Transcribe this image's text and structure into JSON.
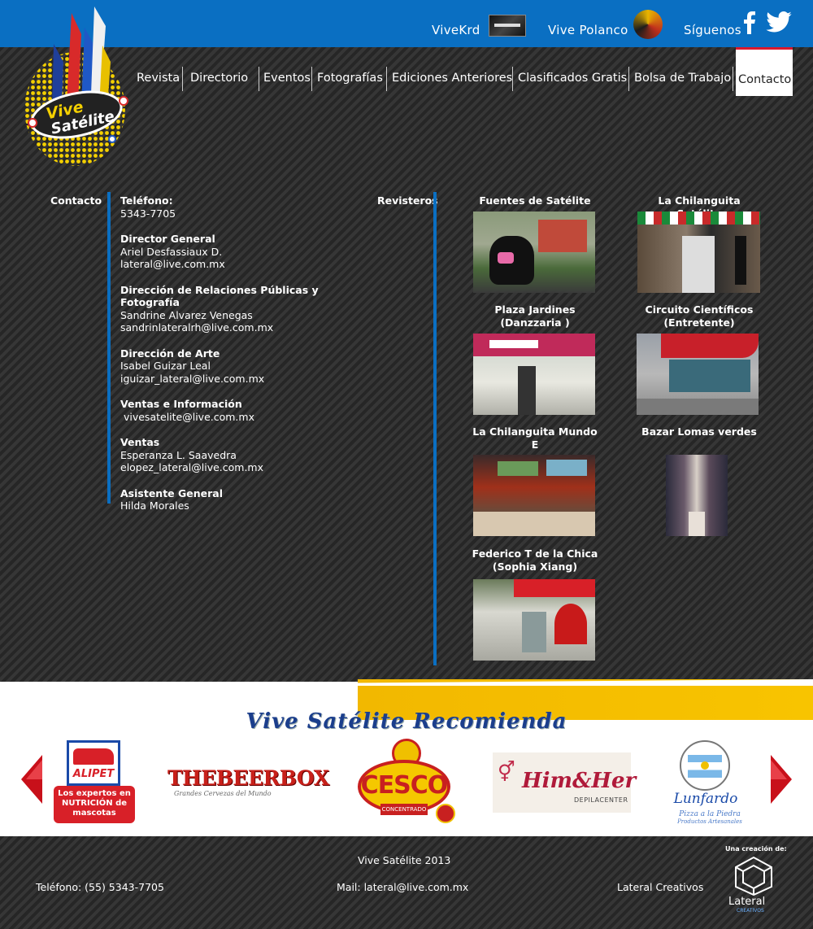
{
  "header": {
    "links": [
      {
        "label": "ViveKrd"
      },
      {
        "label": "Vive Polanco"
      },
      {
        "label": "Síguenos"
      }
    ]
  },
  "logo": {
    "text_top": "Vive",
    "text_bottom": "Satélite"
  },
  "nav": {
    "items": [
      "Revista",
      "Directorio",
      "Eventos",
      "Fotografías",
      "Ediciones Anteriores",
      "Clasificados Gratis",
      "Bolsa de Trabajo",
      "Contacto"
    ],
    "active": "Contacto"
  },
  "contact": {
    "section_label": "Contacto",
    "groups": [
      {
        "title": "Teléfono:",
        "lines": [
          "5343-7705"
        ]
      },
      {
        "title": "Director General",
        "lines": [
          "Ariel Desfassiaux D.",
          "lateral@live.com.mx"
        ]
      },
      {
        "title": "Dirección de Relaciones Públicas y Fotografía",
        "lines": [
          "Sandrine Alvarez Venegas",
          "sandrinlateralrh@live.com.mx"
        ]
      },
      {
        "title": "Dirección de Arte",
        "lines": [
          "Isabel Guizar Leal",
          "iguizar_lateral@live.com.mx"
        ]
      },
      {
        "title": "Ventas e Información",
        "lines": [
          " vivesatelite@live.com.mx"
        ]
      },
      {
        "title": "Ventas",
        "lines": [
          "Esperanza L. Saavedra",
          "elopez_lateral@live.com.mx"
        ]
      },
      {
        "title": "Asistente General",
        "lines": [
          "Hilda Morales"
        ]
      }
    ]
  },
  "revisteros": {
    "section_label": "Revisteros",
    "items": [
      {
        "name": "Fuentes de Satélite"
      },
      {
        "name": "La Chilanguita Satélite"
      },
      {
        "name": "Plaza Jardines (Danzzaria )"
      },
      {
        "name": "Circuito Científicos (Entretente)"
      },
      {
        "name": "La Chilanguita Mundo E"
      },
      {
        "name": "Bazar Lomas verdes"
      },
      {
        "name": "Federico T de la Chica (Sophia Xiang)"
      }
    ]
  },
  "recomienda": {
    "title": "Vive Satélite Recomienda",
    "brands": [
      {
        "name": "ALIPET",
        "tagline": "Los expertos en NUTRICIÓN de mascotas"
      },
      {
        "name": "THEBEERBOX",
        "tagline": "Grandes Cervezas del Mundo"
      },
      {
        "name": "CESCO",
        "tagline": "CONCENTRADO"
      },
      {
        "name": "Him&Her",
        "tagline": "DEPILACENTER"
      },
      {
        "name": "Lunfardo",
        "tagline": "Pizza a la Piedra",
        "sub": "Productos Artesanales",
        "ring": "SABOR ARGENTINO"
      }
    ]
  },
  "footer": {
    "copyright": "Vive Satélite 2013",
    "phone": "Teléfono: (55) 5343-7705",
    "mail": "Mail: lateral@live.com.mx",
    "credit": "Lateral Creativos",
    "creation_label": "Una creación de:",
    "lateral_logo_text": "Lateral",
    "lateral_logo_sub": "CREATIVOS"
  },
  "colors": {
    "blue": "#0a6fc2",
    "yellow": "#f2b800",
    "red_accent": "#d9182d"
  }
}
